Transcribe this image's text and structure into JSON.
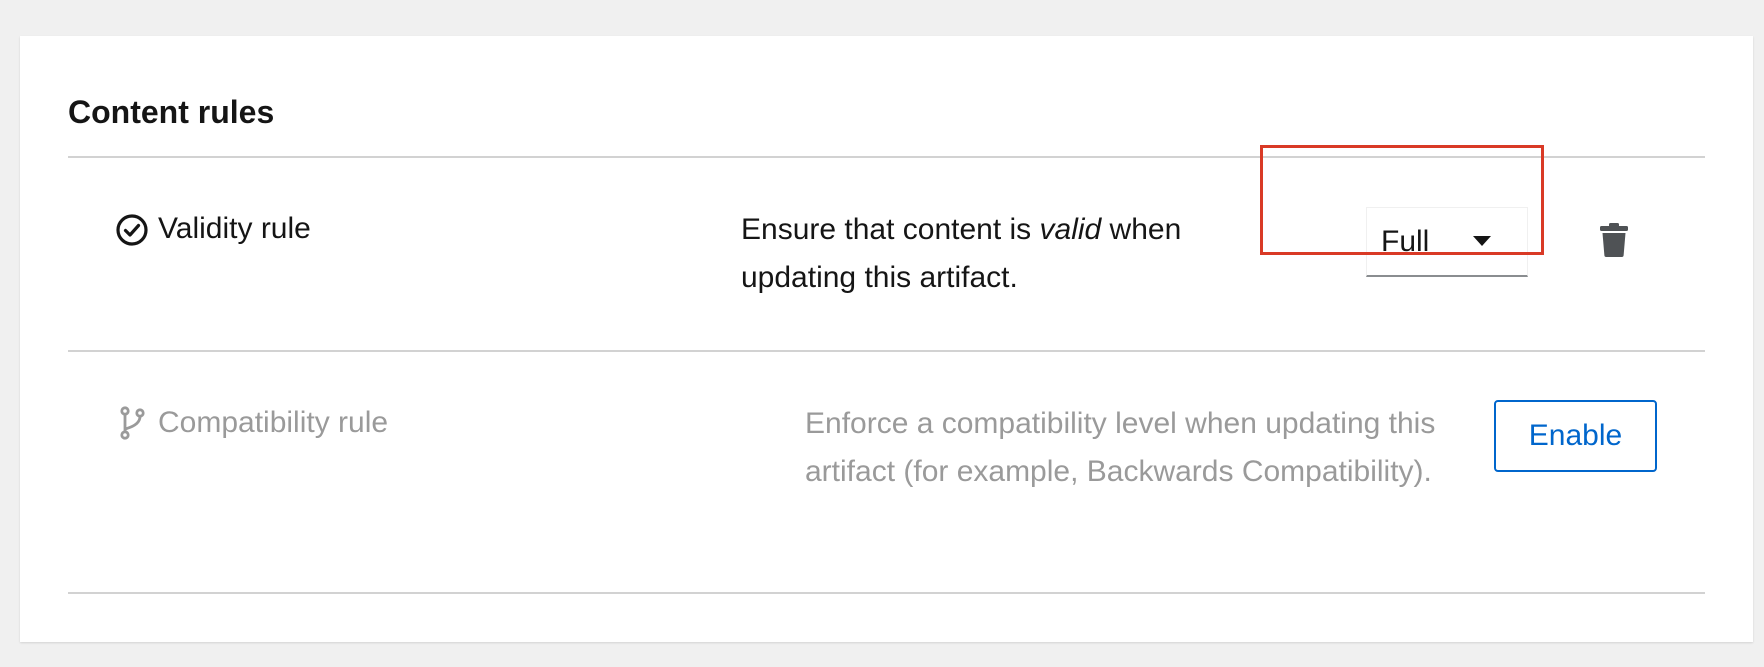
{
  "card": {
    "title": "Content rules"
  },
  "rules": [
    {
      "icon": "check-circle-icon",
      "name": "Validity rule",
      "description_prefix": "Ensure that content is ",
      "description_emphasis": "valid",
      "description_suffix": " when updating this artifact.",
      "enabled": true,
      "select": {
        "value": "Full"
      },
      "delete_icon": "trash-icon"
    },
    {
      "icon": "code-branch-icon",
      "name": "Compatibility rule",
      "description": "Enforce a compatibility level when updating this artifact (for example, Backwards Compatibility).",
      "enabled": false,
      "enable_label": "Enable"
    }
  ],
  "colors": {
    "highlight": "#d93a26",
    "primary": "#0066cc",
    "muted_text": "#9a9a9a",
    "divider": "#d2d2d2",
    "page_background": "#f0f0f0"
  }
}
